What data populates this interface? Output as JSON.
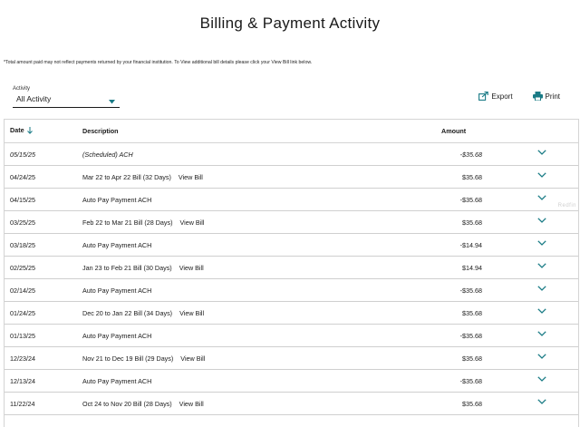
{
  "page": {
    "title": "Billing & Payment Activity",
    "note": "*Total amount paid may not reflect payments returned by your financial institution. To View additional bill details please click your View Bill link below."
  },
  "filter": {
    "label": "Activity",
    "value": "All Activity"
  },
  "actions": {
    "export": "Export",
    "print": "Print"
  },
  "table": {
    "headers": {
      "date": "Date",
      "description": "Description",
      "amount": "Amount"
    },
    "rows": [
      {
        "date": "05/15/25",
        "description": "(Scheduled) ACH",
        "view_bill": "",
        "amount": "-$35.68",
        "scheduled": true
      },
      {
        "date": "04/24/25",
        "description": "Mar 22 to Apr 22 Bill (32 Days)",
        "view_bill": "View Bill",
        "amount": "$35.68"
      },
      {
        "date": "04/15/25",
        "description": "Auto Pay Payment ACH",
        "view_bill": "",
        "amount": "-$35.68"
      },
      {
        "date": "03/25/25",
        "description": "Feb 22 to Mar 21 Bill (28 Days)",
        "view_bill": "View Bill",
        "amount": "$35.68"
      },
      {
        "date": "03/18/25",
        "description": "Auto Pay Payment ACH",
        "view_bill": "",
        "amount": "-$14.94"
      },
      {
        "date": "02/25/25",
        "description": "Jan 23 to Feb 21 Bill (30 Days)",
        "view_bill": "View Bill",
        "amount": "$14.94"
      },
      {
        "date": "02/14/25",
        "description": "Auto Pay Payment ACH",
        "view_bill": "",
        "amount": "-$35.68"
      },
      {
        "date": "01/24/25",
        "description": "Dec 20 to Jan 22 Bill (34 Days)",
        "view_bill": "View Bill",
        "amount": "$35.68"
      },
      {
        "date": "01/13/25",
        "description": "Auto Pay Payment ACH",
        "view_bill": "",
        "amount": "-$35.68"
      },
      {
        "date": "12/23/24",
        "description": "Nov 21 to Dec 19 Bill (29 Days)",
        "view_bill": "View Bill",
        "amount": "$35.68"
      },
      {
        "date": "12/13/24",
        "description": "Auto Pay Payment ACH",
        "view_bill": "",
        "amount": "-$35.68"
      },
      {
        "date": "11/22/24",
        "description": "Oct 24 to Nov 20 Bill (28 Days)",
        "view_bill": "View Bill",
        "amount": "$35.68"
      }
    ]
  },
  "watermark": "Redfin",
  "colors": {
    "accent": "#1a7b86",
    "text": "#1a1a1a",
    "border": "#d4d4d4"
  },
  "icons": {
    "sort": "arrow-down-icon",
    "expand": "chevron-down-icon",
    "export": "export-icon",
    "print": "printer-icon",
    "dropdown": "caret-down-icon"
  }
}
